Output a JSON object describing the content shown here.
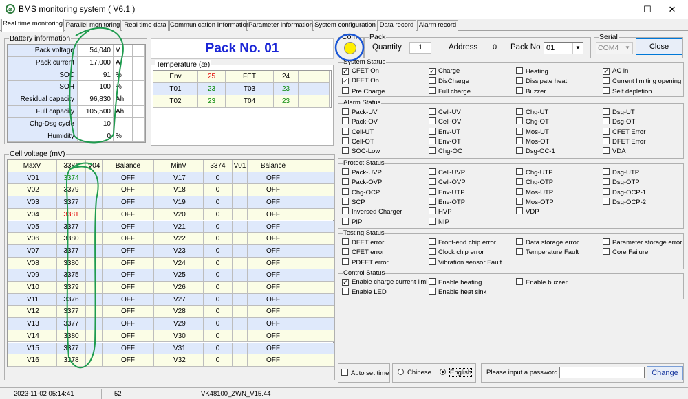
{
  "window": {
    "title": "BMS monitoring system  ( V6.1 )",
    "min_label": "—",
    "max_label": "☐",
    "close_label": "✕"
  },
  "tabs": [
    "Real time monitoring",
    "Parallel monitoring",
    "Real time data",
    "Communication Information",
    "Parameter information",
    "System configuration",
    "Data record",
    "Alarm record"
  ],
  "battery": {
    "title": "Battery information",
    "rows": [
      {
        "label": "Pack voltage",
        "value": "54,040",
        "unit": "V"
      },
      {
        "label": "Pack current",
        "value": "17,000",
        "unit": "A"
      },
      {
        "label": "SOC",
        "value": "91",
        "unit": "%"
      },
      {
        "label": "SOH",
        "value": "100",
        "unit": "%"
      },
      {
        "label": "Residual capacity",
        "value": "96,830",
        "unit": "Ah"
      },
      {
        "label": "Full capacity",
        "value": "105,500",
        "unit": "Ah"
      },
      {
        "label": "Chg-Dsg cycle",
        "value": "10",
        "unit": ""
      },
      {
        "label": "Humidity",
        "value": "0",
        "unit": "%"
      }
    ]
  },
  "pack_title": "Pack No. 01",
  "temperature": {
    "title": "Temperature (æ)",
    "rows": [
      {
        "l1": "Env",
        "v1": "25",
        "c1": "#e00000",
        "l2": "FET",
        "v2": "24",
        "c2": "#000000"
      },
      {
        "l1": "T01",
        "v1": "23",
        "c1": "#0a8a0a",
        "l2": "T03",
        "v2": "23",
        "c2": "#0a8a0a"
      },
      {
        "l1": "T02",
        "v1": "23",
        "c1": "#0a8a0a",
        "l2": "T04",
        "v2": "23",
        "c2": "#0a8a0a"
      }
    ]
  },
  "cells": {
    "title": "Cell voltage (mV)",
    "header": {
      "maxv": "MaxV",
      "maxval": "3381",
      "maxid": "V04",
      "bal": "Balance",
      "minv": "MinV",
      "minval": "3374",
      "minid": "V01",
      "bal2": "Balance"
    },
    "left": [
      {
        "id": "V01",
        "v": "3374",
        "c": "#0a8a0a",
        "b": "OFF"
      },
      {
        "id": "V02",
        "v": "3379",
        "c": "#000000",
        "b": "OFF"
      },
      {
        "id": "V03",
        "v": "3377",
        "c": "#000000",
        "b": "OFF"
      },
      {
        "id": "V04",
        "v": "3381",
        "c": "#e00000",
        "b": "OFF"
      },
      {
        "id": "V05",
        "v": "3377",
        "c": "#000000",
        "b": "OFF"
      },
      {
        "id": "V06",
        "v": "3380",
        "c": "#000000",
        "b": "OFF"
      },
      {
        "id": "V07",
        "v": "3377",
        "c": "#000000",
        "b": "OFF"
      },
      {
        "id": "V08",
        "v": "3380",
        "c": "#000000",
        "b": "OFF"
      },
      {
        "id": "V09",
        "v": "3375",
        "c": "#000000",
        "b": "OFF"
      },
      {
        "id": "V10",
        "v": "3379",
        "c": "#000000",
        "b": "OFF"
      },
      {
        "id": "V11",
        "v": "3376",
        "c": "#000000",
        "b": "OFF"
      },
      {
        "id": "V12",
        "v": "3377",
        "c": "#000000",
        "b": "OFF"
      },
      {
        "id": "V13",
        "v": "3377",
        "c": "#000000",
        "b": "OFF"
      },
      {
        "id": "V14",
        "v": "3380",
        "c": "#000000",
        "b": "OFF"
      },
      {
        "id": "V15",
        "v": "3377",
        "c": "#000000",
        "b": "OFF"
      },
      {
        "id": "V16",
        "v": "3378",
        "c": "#000000",
        "b": "OFF"
      }
    ],
    "right": [
      {
        "id": "V17",
        "v": "0",
        "b": "OFF"
      },
      {
        "id": "V18",
        "v": "0",
        "b": "OFF"
      },
      {
        "id": "V19",
        "v": "0",
        "b": "OFF"
      },
      {
        "id": "V20",
        "v": "0",
        "b": "OFF"
      },
      {
        "id": "V21",
        "v": "0",
        "b": "OFF"
      },
      {
        "id": "V22",
        "v": "0",
        "b": "OFF"
      },
      {
        "id": "V23",
        "v": "0",
        "b": "OFF"
      },
      {
        "id": "V24",
        "v": "0",
        "b": "OFF"
      },
      {
        "id": "V25",
        "v": "0",
        "b": "OFF"
      },
      {
        "id": "V26",
        "v": "0",
        "b": "OFF"
      },
      {
        "id": "V27",
        "v": "0",
        "b": "OFF"
      },
      {
        "id": "V28",
        "v": "0",
        "b": "OFF"
      },
      {
        "id": "V29",
        "v": "0",
        "b": "OFF"
      },
      {
        "id": "V30",
        "v": "0",
        "b": "OFF"
      },
      {
        "id": "V31",
        "v": "0",
        "b": "OFF"
      },
      {
        "id": "V32",
        "v": "0",
        "b": "OFF"
      }
    ]
  },
  "comm": {
    "title": "Com",
    "indicator_color": "#ffee00"
  },
  "pack": {
    "title": "Pack",
    "quantity_label": "Quantity",
    "quantity_value": "1",
    "address_label": "Address",
    "address_value": "0",
    "packno_label": "Pack No",
    "packno_value": "01"
  },
  "serial": {
    "title": "Serial",
    "port": "COM4",
    "close_label": "Close"
  },
  "system_status": {
    "title": "System Status",
    "items": [
      {
        "label": "CFET On",
        "checked": true
      },
      {
        "label": "Charge",
        "checked": true
      },
      {
        "label": "Heating",
        "checked": false
      },
      {
        "label": "AC in",
        "checked": true
      },
      {
        "label": "DFET On",
        "checked": true
      },
      {
        "label": "DisCharge",
        "checked": false
      },
      {
        "label": "Dissipate heat",
        "checked": false
      },
      {
        "label": "Current limiting opening",
        "checked": false
      },
      {
        "label": "Pre Charge",
        "checked": false
      },
      {
        "label": "Full charge",
        "checked": false
      },
      {
        "label": "Buzzer",
        "checked": false
      },
      {
        "label": "Self depletion",
        "checked": false
      }
    ]
  },
  "alarm_status": {
    "title": "Alarm Status",
    "items": [
      {
        "label": "Pack-UV",
        "checked": false
      },
      {
        "label": "Cell-UV",
        "checked": false
      },
      {
        "label": "Chg-UT",
        "checked": false
      },
      {
        "label": "Dsg-UT",
        "checked": false
      },
      {
        "label": "Pack-OV",
        "checked": false
      },
      {
        "label": "Cell-OV",
        "checked": false
      },
      {
        "label": "Chg-OT",
        "checked": false
      },
      {
        "label": "Dsg-OT",
        "checked": false
      },
      {
        "label": "Cell-UT",
        "checked": false
      },
      {
        "label": "Env-UT",
        "checked": false
      },
      {
        "label": "Mos-UT",
        "checked": false
      },
      {
        "label": "CFET Error",
        "checked": false
      },
      {
        "label": "Cell-OT",
        "checked": false
      },
      {
        "label": "Env-OT",
        "checked": false
      },
      {
        "label": "Mos-OT",
        "checked": false
      },
      {
        "label": "DFET Error",
        "checked": false
      },
      {
        "label": "SOC-Low",
        "checked": false
      },
      {
        "label": "Chg-OC",
        "checked": false
      },
      {
        "label": "Dsg-OC-1",
        "checked": false
      },
      {
        "label": "VDA",
        "checked": false
      }
    ]
  },
  "protect_status": {
    "title": "Protect Status",
    "items": [
      {
        "label": "Pack-UVP",
        "checked": false
      },
      {
        "label": "Cell-UVP",
        "checked": false
      },
      {
        "label": "Chg-UTP",
        "checked": false
      },
      {
        "label": "Dsg-UTP",
        "checked": false
      },
      {
        "label": "Pack-OVP",
        "checked": false
      },
      {
        "label": "Cell-OVP",
        "checked": false
      },
      {
        "label": "Chg-OTP",
        "checked": false
      },
      {
        "label": "Dsg-OTP",
        "checked": false
      },
      {
        "label": "Chg-OCP",
        "checked": false
      },
      {
        "label": "Env-UTP",
        "checked": false
      },
      {
        "label": "Mos-UTP",
        "checked": false
      },
      {
        "label": "Dsg-OCP-1",
        "checked": false
      },
      {
        "label": "SCP",
        "checked": false
      },
      {
        "label": "Env-OTP",
        "checked": false
      },
      {
        "label": "Mos-OTP",
        "checked": false
      },
      {
        "label": "Dsg-OCP-2",
        "checked": false
      },
      {
        "label": "Inversed Charger",
        "checked": false
      },
      {
        "label": "HVP",
        "checked": false
      },
      {
        "label": "VDP",
        "checked": false
      },
      {
        "label": "",
        "checked": false
      },
      {
        "label": "PIP",
        "checked": false
      },
      {
        "label": "NIP",
        "checked": false
      },
      {
        "label": "",
        "checked": false
      },
      {
        "label": "",
        "checked": false
      }
    ]
  },
  "testing_status": {
    "title": "Testing Status",
    "items": [
      {
        "label": "DFET error",
        "checked": false
      },
      {
        "label": "Front-end chip error",
        "checked": false
      },
      {
        "label": "Data storage error",
        "checked": false
      },
      {
        "label": "Parameter storage error",
        "checked": false
      },
      {
        "label": "CFET error",
        "checked": false
      },
      {
        "label": "Clock chip error",
        "checked": false
      },
      {
        "label": "Temperature Fault",
        "checked": false
      },
      {
        "label": "Core Failure",
        "checked": false
      },
      {
        "label": "PDFET error",
        "checked": false
      },
      {
        "label": "Vibration sensor Fault",
        "checked": false
      },
      {
        "label": "",
        "checked": false
      },
      {
        "label": "",
        "checked": false
      }
    ]
  },
  "control_status": {
    "title": "Control Status",
    "items": [
      {
        "label": "Enable charge current limi",
        "checked": true
      },
      {
        "label": "Enable heating",
        "checked": false
      },
      {
        "label": "Enable buzzer",
        "checked": false
      },
      {
        "label": "",
        "checked": false
      },
      {
        "label": "Enable LED",
        "checked": false
      },
      {
        "label": "Enable heat sink",
        "checked": false
      },
      {
        "label": "",
        "checked": false
      },
      {
        "label": "",
        "checked": false
      }
    ]
  },
  "bottom": {
    "auto_set_time": "Auto set time",
    "chinese": "Chinese",
    "english": "English",
    "password_label": "Please input a password",
    "password_value": "",
    "change_label": "Change"
  },
  "statusbar": {
    "datetime": "2023-11-02 05:14:41",
    "count": "52",
    "firmware": "VK48100_ZWN_V15.44"
  },
  "annotations": {
    "stroke_color": "#1e9b4e",
    "circle_color": "#1a56d6"
  }
}
